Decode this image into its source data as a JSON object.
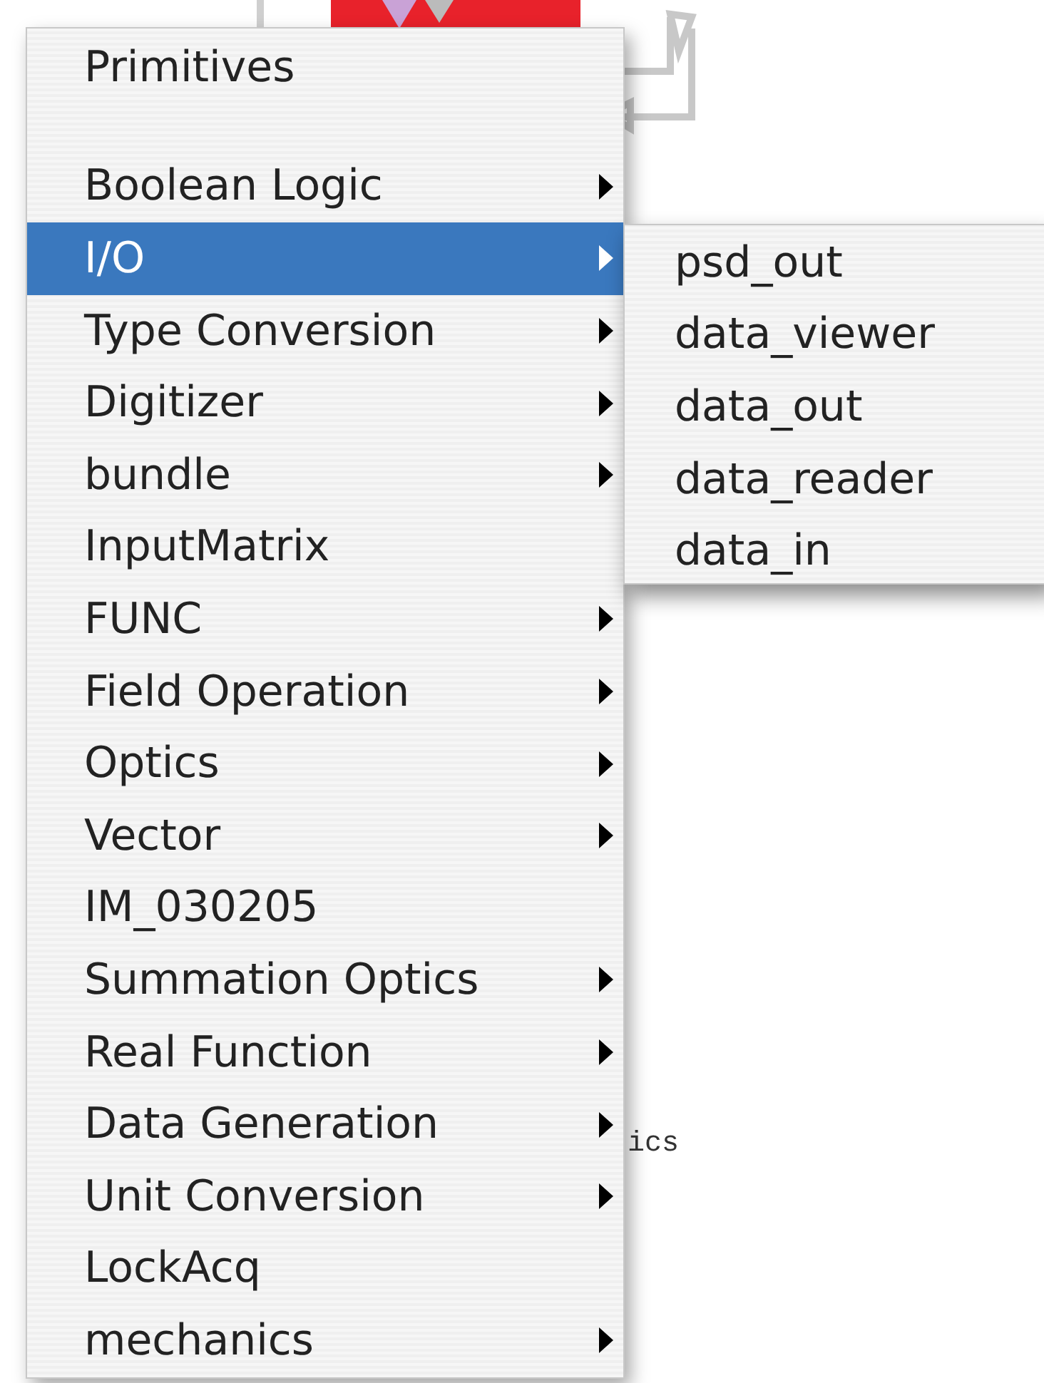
{
  "canvas": {
    "label": "ics"
  },
  "menu": {
    "items": [
      {
        "kind": "item",
        "label": "Primitives",
        "submenu": false,
        "selected": false
      },
      {
        "kind": "separator"
      },
      {
        "kind": "item",
        "label": "Boolean Logic",
        "submenu": true,
        "selected": false
      },
      {
        "kind": "item",
        "label": "I/O",
        "submenu": true,
        "selected": true
      },
      {
        "kind": "item",
        "label": "Type Conversion",
        "submenu": true,
        "selected": false
      },
      {
        "kind": "item",
        "label": "Digitizer",
        "submenu": true,
        "selected": false
      },
      {
        "kind": "item",
        "label": "bundle",
        "submenu": true,
        "selected": false
      },
      {
        "kind": "item",
        "label": "InputMatrix",
        "submenu": false,
        "selected": false
      },
      {
        "kind": "item",
        "label": "FUNC",
        "submenu": true,
        "selected": false
      },
      {
        "kind": "item",
        "label": "Field Operation",
        "submenu": true,
        "selected": false
      },
      {
        "kind": "item",
        "label": "Optics",
        "submenu": true,
        "selected": false
      },
      {
        "kind": "item",
        "label": "Vector",
        "submenu": true,
        "selected": false
      },
      {
        "kind": "item",
        "label": "IM_030205",
        "submenu": false,
        "selected": false
      },
      {
        "kind": "item",
        "label": "Summation Optics",
        "submenu": true,
        "selected": false
      },
      {
        "kind": "item",
        "label": "Real Function",
        "submenu": true,
        "selected": false
      },
      {
        "kind": "item",
        "label": "Data Generation",
        "submenu": true,
        "selected": false
      },
      {
        "kind": "item",
        "label": "Unit Conversion",
        "submenu": true,
        "selected": false
      },
      {
        "kind": "item",
        "label": "LockAcq",
        "submenu": false,
        "selected": false
      },
      {
        "kind": "item",
        "label": "mechanics",
        "submenu": true,
        "selected": false
      }
    ]
  },
  "submenu": {
    "items": [
      {
        "label": "psd_out"
      },
      {
        "label": "data_viewer"
      },
      {
        "label": "data_out"
      },
      {
        "label": "data_reader"
      },
      {
        "label": "data_in"
      }
    ]
  }
}
